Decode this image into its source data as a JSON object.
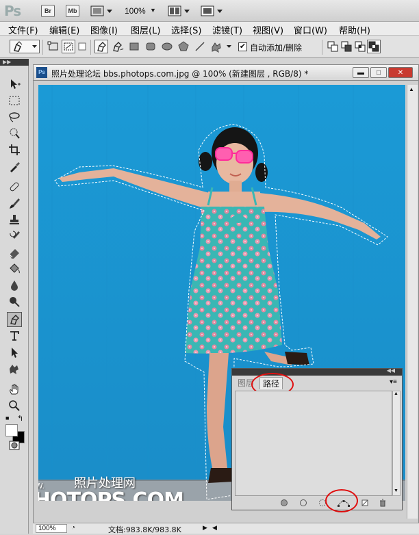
{
  "app": {
    "logo": "Ps",
    "bridge_label": "Br",
    "minibridge_label": "Mb",
    "zoom": "100%"
  },
  "menu": [
    "文件(F)",
    "编辑(E)",
    "图像(I)",
    "图层(L)",
    "选择(S)",
    "滤镜(T)",
    "视图(V)",
    "窗口(W)",
    "帮助(H)"
  ],
  "options": {
    "auto_add_delete_label": "自动添加/删除",
    "auto_add_delete_checked": true
  },
  "document": {
    "title": "照片处理论坛 bbs.photops.com.jpg @ 100% (新建图层 , RGB/8) *"
  },
  "panel": {
    "tab_layers": "图层",
    "tab_paths": "路径"
  },
  "status": {
    "zoom": "100%",
    "doc_size": "文档:983.8K/983.8K"
  },
  "watermark": {
    "line1": "照片处理网",
    "prefix": "WWW.",
    "line2": "PHOTOPS.COM"
  },
  "colors": {
    "wall": "#1ea0dd",
    "annotation": "#e01010"
  }
}
